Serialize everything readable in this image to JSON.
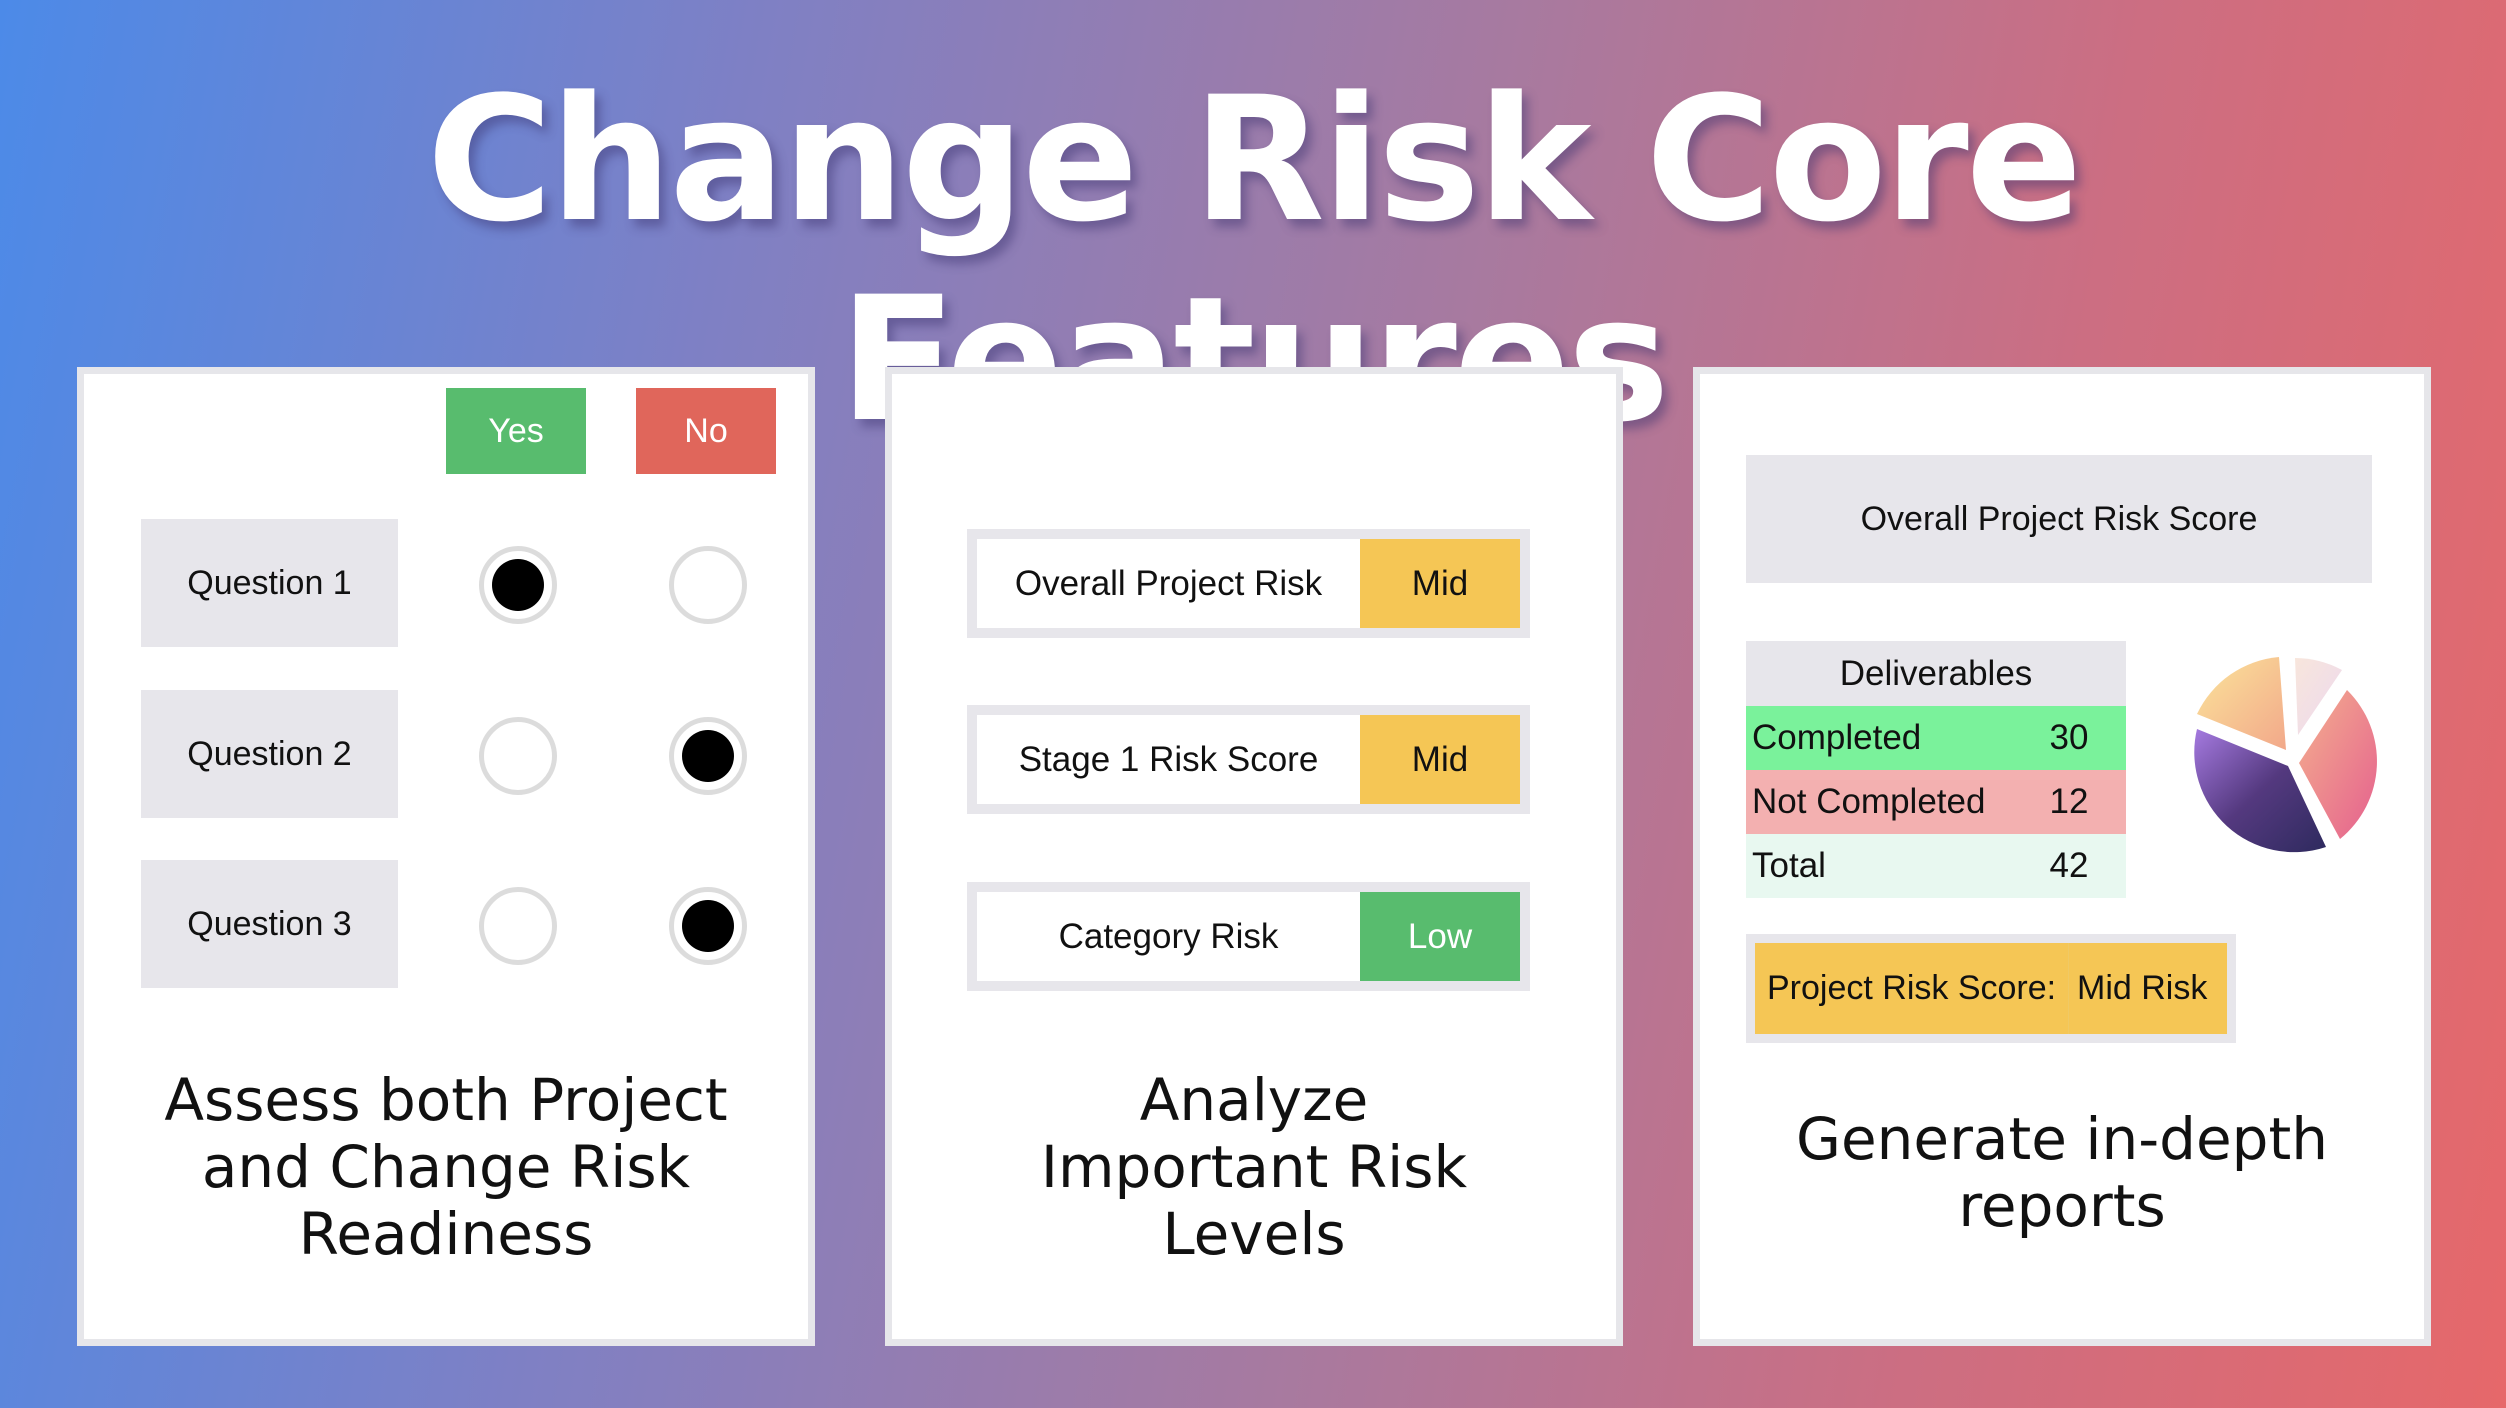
{
  "title": "Change Risk Core Features",
  "colors": {
    "yes": "#58bc6e",
    "no": "#e0665b",
    "mid": "#f5c655",
    "low": "#58bc6e",
    "panel_gray": "#e7e6eb",
    "completed": "#7af29b",
    "not_completed": "#f3b0b0",
    "total": "#e8f8f0"
  },
  "card1": {
    "yes_label": "Yes",
    "no_label": "No",
    "questions": [
      {
        "label": "Question 1",
        "answer": "yes"
      },
      {
        "label": "Question 2",
        "answer": "no"
      },
      {
        "label": "Question 3",
        "answer": "no"
      }
    ],
    "caption": [
      "Assess both Project",
      "and Change Risk",
      "Readiness"
    ]
  },
  "card2": {
    "rows": [
      {
        "label": "Overall Project Risk",
        "level": "Mid",
        "status": "mid"
      },
      {
        "label": "Stage 1 Risk Score",
        "level": "Mid",
        "status": "mid"
      },
      {
        "label": "Category Risk",
        "level": "Low",
        "status": "low"
      }
    ],
    "caption": [
      "Analyze",
      "Important Risk",
      "Levels"
    ]
  },
  "card3": {
    "header": "Overall Project Risk Score",
    "deliverables": {
      "title": "Deliverables",
      "rows": [
        {
          "label": "Completed",
          "value": "30",
          "status": "completed"
        },
        {
          "label": "Not Completed",
          "value": "12",
          "status": "not_completed"
        },
        {
          "label": "Total",
          "value": "42",
          "status": "total"
        }
      ]
    },
    "pie_icon": "pie-chart-icon",
    "score_label": "Project Risk Score:",
    "score_value": "Mid Risk",
    "caption": [
      "Generate in-depth",
      "reports"
    ]
  }
}
